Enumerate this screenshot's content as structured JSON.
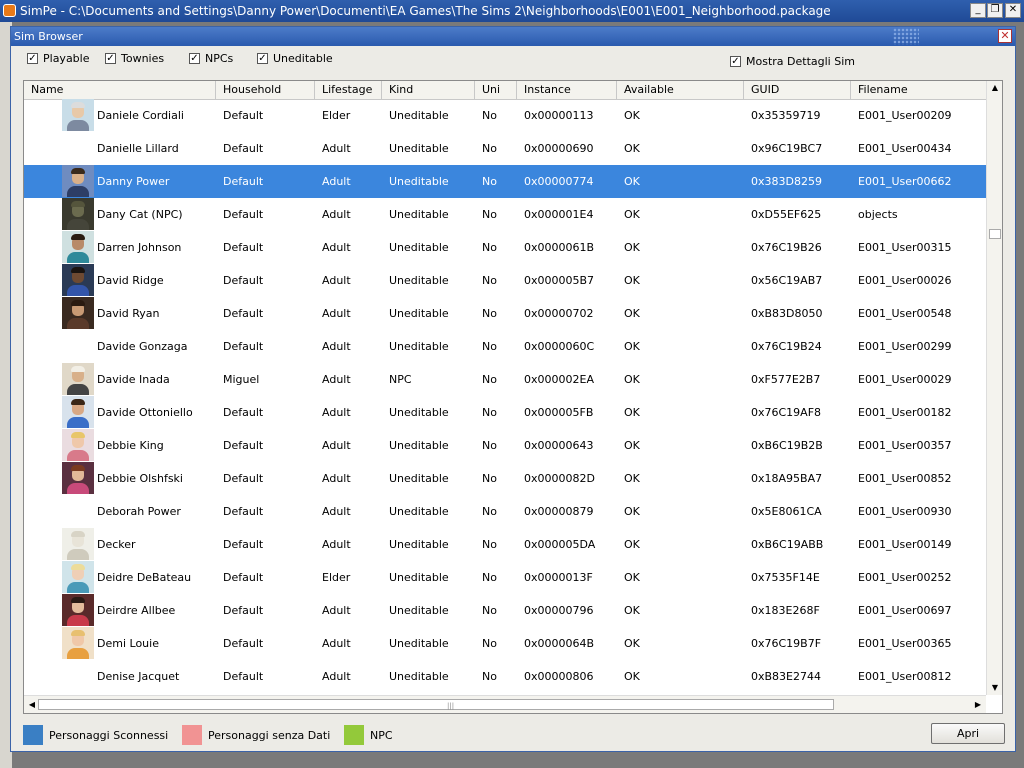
{
  "app": {
    "title": "SimPe - C:\\Documents and Settings\\Danny Power\\Documenti\\EA Games\\The Sims 2\\Neighborhoods\\E001\\E001_Neighborhood.package",
    "minimize": "_",
    "maximize": "❐",
    "close": "✕"
  },
  "dialog": {
    "title": "Sim Browser",
    "close": "✕"
  },
  "filters": [
    {
      "label": "Playable",
      "checked": true
    },
    {
      "label": "Townies",
      "checked": true
    },
    {
      "label": "NPCs",
      "checked": true
    },
    {
      "label": "Uneditable",
      "checked": true
    }
  ],
  "details": {
    "label": "Mostra Dettagli Sim",
    "checked": true
  },
  "columns": [
    "Name",
    "Household",
    "Lifestage",
    "Kind",
    "Uni",
    "Instance",
    "Available",
    "GUID",
    "Filename"
  ],
  "rows": [
    {
      "name": "Daniele Cordiali",
      "household": "Default",
      "lifestage": "Elder",
      "kind": "Uneditable",
      "uni": "No",
      "instance": "0x00000113",
      "available": "OK",
      "guid": "0x35359719",
      "filename": "E001_User00209",
      "thumb": "elder-male"
    },
    {
      "name": "Danielle Lillard",
      "household": "Default",
      "lifestage": "Adult",
      "kind": "Uneditable",
      "uni": "No",
      "instance": "0x00000690",
      "available": "OK",
      "guid": "0x96C19BC7",
      "filename": "E001_User00434",
      "thumb": ""
    },
    {
      "name": "Danny Power",
      "household": "Default",
      "lifestage": "Adult",
      "kind": "Uneditable",
      "uni": "No",
      "instance": "0x00000774",
      "available": "OK",
      "guid": "0x383D8259",
      "filename": "E001_User00662",
      "thumb": "male-dark",
      "selected": true
    },
    {
      "name": "Dany Cat (NPC)",
      "household": "Default",
      "lifestage": "Adult",
      "kind": "Uneditable",
      "uni": "No",
      "instance": "0x000001E4",
      "available": "OK",
      "guid": "0xD55EF625",
      "filename": "objects",
      "thumb": "cat"
    },
    {
      "name": "Darren Johnson",
      "household": "Default",
      "lifestage": "Adult",
      "kind": "Uneditable",
      "uni": "No",
      "instance": "0x0000061B",
      "available": "OK",
      "guid": "0x76C19B26",
      "filename": "E001_User00315",
      "thumb": "male-teal"
    },
    {
      "name": "David Ridge",
      "household": "Default",
      "lifestage": "Adult",
      "kind": "Uneditable",
      "uni": "No",
      "instance": "0x000005B7",
      "available": "OK",
      "guid": "0x56C19AB7",
      "filename": "E001_User00026",
      "thumb": "male-darkskin"
    },
    {
      "name": "David Ryan",
      "household": "Default",
      "lifestage": "Adult",
      "kind": "Uneditable",
      "uni": "No",
      "instance": "0x00000702",
      "available": "OK",
      "guid": "0xB83D8050",
      "filename": "E001_User00548",
      "thumb": "male-brown"
    },
    {
      "name": "Davide Gonzaga",
      "household": "Default",
      "lifestage": "Adult",
      "kind": "Uneditable",
      "uni": "No",
      "instance": "0x0000060C",
      "available": "OK",
      "guid": "0x76C19B24",
      "filename": "E001_User00299",
      "thumb": ""
    },
    {
      "name": "Davide Inada",
      "household": "Miguel",
      "lifestage": "Adult",
      "kind": "NPC",
      "uni": "No",
      "instance": "0x000002EA",
      "available": "OK",
      "guid": "0xF577E2B7",
      "filename": "E001_User00029",
      "thumb": "male-hat"
    },
    {
      "name": "Davide Ottoniello",
      "household": "Default",
      "lifestage": "Adult",
      "kind": "Uneditable",
      "uni": "No",
      "instance": "0x000005FB",
      "available": "OK",
      "guid": "0x76C19AF8",
      "filename": "E001_User00182",
      "thumb": "male-blue"
    },
    {
      "name": "Debbie King",
      "household": "Default",
      "lifestage": "Adult",
      "kind": "Uneditable",
      "uni": "No",
      "instance": "0x00000643",
      "available": "OK",
      "guid": "0xB6C19B2B",
      "filename": "E001_User00357",
      "thumb": "female-blonde"
    },
    {
      "name": "Debbie Olshfski",
      "household": "Default",
      "lifestage": "Adult",
      "kind": "Uneditable",
      "uni": "No",
      "instance": "0x0000082D",
      "available": "OK",
      "guid": "0x18A95BA7",
      "filename": "E001_User00852",
      "thumb": "female-pink"
    },
    {
      "name": "Deborah Power",
      "household": "Default",
      "lifestage": "Adult",
      "kind": "Uneditable",
      "uni": "No",
      "instance": "0x00000879",
      "available": "OK",
      "guid": "0x5E8061CA",
      "filename": "E001_User00930",
      "thumb": ""
    },
    {
      "name": "Decker",
      "household": "Default",
      "lifestage": "Adult",
      "kind": "Uneditable",
      "uni": "No",
      "instance": "0x000005DA",
      "available": "OK",
      "guid": "0xB6C19ABB",
      "filename": "E001_User00149",
      "thumb": "dog"
    },
    {
      "name": "Deidre DeBateau",
      "household": "Default",
      "lifestage": "Elder",
      "kind": "Uneditable",
      "uni": "No",
      "instance": "0x0000013F",
      "available": "OK",
      "guid": "0x7535F14E",
      "filename": "E001_User00252",
      "thumb": "female-elder"
    },
    {
      "name": "Deirdre Allbee",
      "household": "Default",
      "lifestage": "Adult",
      "kind": "Uneditable",
      "uni": "No",
      "instance": "0x00000796",
      "available": "OK",
      "guid": "0x183E268F",
      "filename": "E001_User00697",
      "thumb": "female-dark"
    },
    {
      "name": "Demi Louie",
      "household": "Default",
      "lifestage": "Adult",
      "kind": "Uneditable",
      "uni": "No",
      "instance": "0x0000064B",
      "available": "OK",
      "guid": "0x76C19B7F",
      "filename": "E001_User00365",
      "thumb": "female-orange"
    },
    {
      "name": "Denise Jacquet",
      "household": "Default",
      "lifestage": "Adult",
      "kind": "Uneditable",
      "uni": "No",
      "instance": "0x00000806",
      "available": "OK",
      "guid": "0xB83E2744",
      "filename": "E001_User00812",
      "thumb": ""
    }
  ],
  "legend": [
    {
      "label": "Personaggi Sconnessi",
      "color": "#3a7fc4"
    },
    {
      "label": "Personaggi senza Dati",
      "color": "#f19393"
    },
    {
      "label": "NPC",
      "color": "#93c93a"
    }
  ],
  "open_button": "Apri",
  "colors": {
    "selection": "#3b86dd",
    "title_bar": "#2a5aae"
  },
  "icons": {
    "app": "simpe-icon",
    "check": "check-icon",
    "scroll_up": "arrow-up-icon",
    "scroll_down": "arrow-down-icon",
    "scroll_left": "arrow-left-icon",
    "scroll_right": "arrow-right-icon"
  }
}
